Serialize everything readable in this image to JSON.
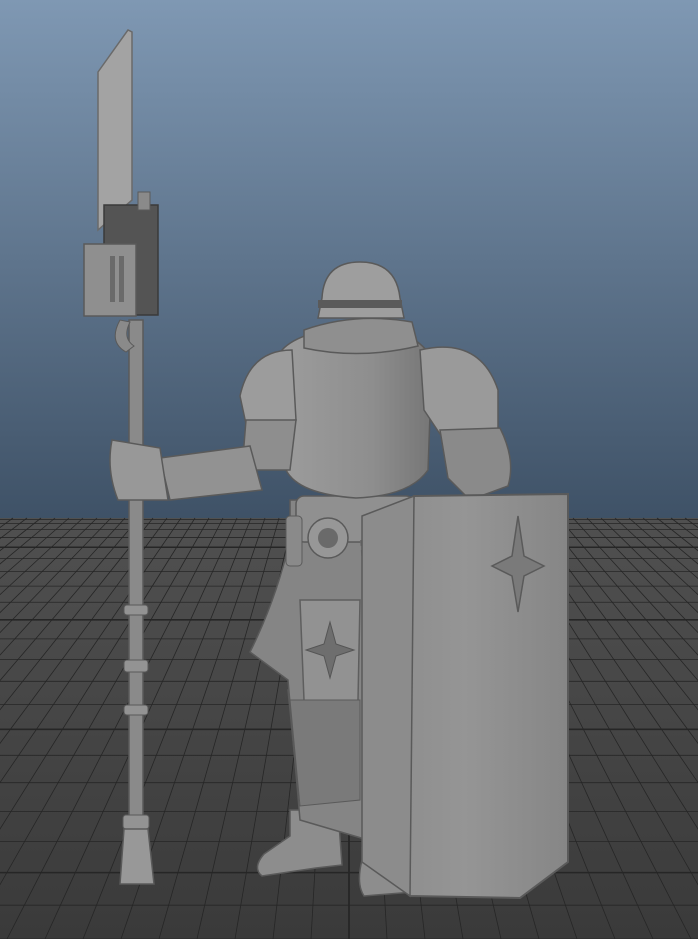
{
  "viewport": {
    "panel_label": "",
    "colors": {
      "sky_top": "#7f98b3",
      "sky_bottom": "#3e5166",
      "floor": "#404040",
      "grid_line": "#262626",
      "model_fill": "#8c8c8c",
      "model_light": "#a6a6a6",
      "model_dark": "#616161",
      "outline": "#555555"
    },
    "model": {
      "subject": "armored-guard-with-halberd-and-tower-shield"
    }
  }
}
